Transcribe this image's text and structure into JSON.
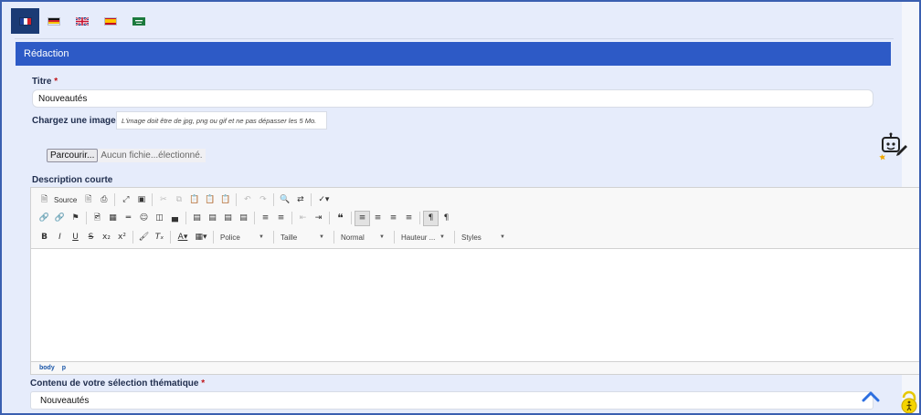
{
  "languages": [
    {
      "code": "fr",
      "name": "Français",
      "active": true
    },
    {
      "code": "de",
      "name": "Deutsch",
      "active": false
    },
    {
      "code": "gb",
      "name": "English",
      "active": false
    },
    {
      "code": "es",
      "name": "Español",
      "active": false
    },
    {
      "code": "sa",
      "name": "العربية",
      "active": false
    }
  ],
  "section": {
    "title": "Rédaction"
  },
  "titre": {
    "label": "Titre",
    "required": "*",
    "value": "Nouveautés"
  },
  "image": {
    "label": "Chargez une image",
    "hint": "L'image doit être de jpg, png ou gif et ne pas dépasser les 5 Mo.",
    "browse_label": "Parcourir...",
    "file_status": "Aucun fichie...électionné."
  },
  "description": {
    "label": "Description courte"
  },
  "editor": {
    "source_label": "Source",
    "font_combo": "Police",
    "size_combo": "Taille",
    "format_combo": "Normal",
    "height_combo": "Hauteur ...",
    "styles_combo": "Styles",
    "path": [
      "body",
      "p"
    ]
  },
  "contenu": {
    "label": "Contenu de votre sélection thématique",
    "required": "*",
    "value": "Nouveautés"
  },
  "colors": {
    "accent": "#2d5ac6",
    "tab_active": "#1b3b75",
    "background": "#e6ecfb",
    "required": "#c0151a"
  }
}
